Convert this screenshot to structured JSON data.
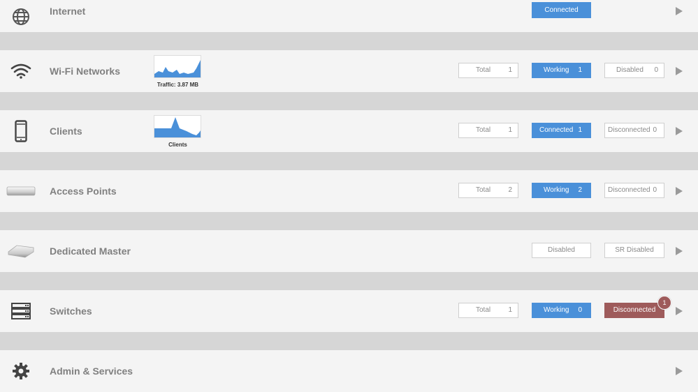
{
  "rows": {
    "internet": {
      "title": "Internet",
      "status": "Connected"
    },
    "wifi": {
      "title": "Wi-Fi Networks",
      "chart_label": "Traffic: 3.87 MB",
      "total_label": "Total",
      "total": "1",
      "working_label": "Working",
      "working": "1",
      "disabled_label": "Disabled",
      "disabled": "0"
    },
    "clients": {
      "title": "Clients",
      "chart_label": "Clients",
      "total_label": "Total",
      "total": "1",
      "connected_label": "Connected",
      "connected": "1",
      "disconnected_label": "Disconnected",
      "disconnected": "0"
    },
    "access_points": {
      "title": "Access Points",
      "total_label": "Total",
      "total": "2",
      "working_label": "Working",
      "working": "2",
      "disconnected_label": "Disconnected",
      "disconnected": "0"
    },
    "dedicated_master": {
      "title": "Dedicated Master",
      "status": "Disabled",
      "sr_status": "SR Disabled"
    },
    "switches": {
      "title": "Switches",
      "total_label": "Total",
      "total": "1",
      "working_label": "Working",
      "working": "0",
      "disconnected_label": "Disconnected",
      "alert_count": "1"
    },
    "admin": {
      "title": "Admin & Services"
    }
  },
  "colors": {
    "accent": "#4a90d9",
    "alert": "#9e5b5b",
    "band": "#f4f4f4",
    "gap": "#d6d6d6"
  },
  "icons": [
    "globe-icon",
    "wifi-icon",
    "phone-icon",
    "access-point-icon",
    "dedicated-master-icon",
    "switch-icon",
    "gear-icon"
  ]
}
